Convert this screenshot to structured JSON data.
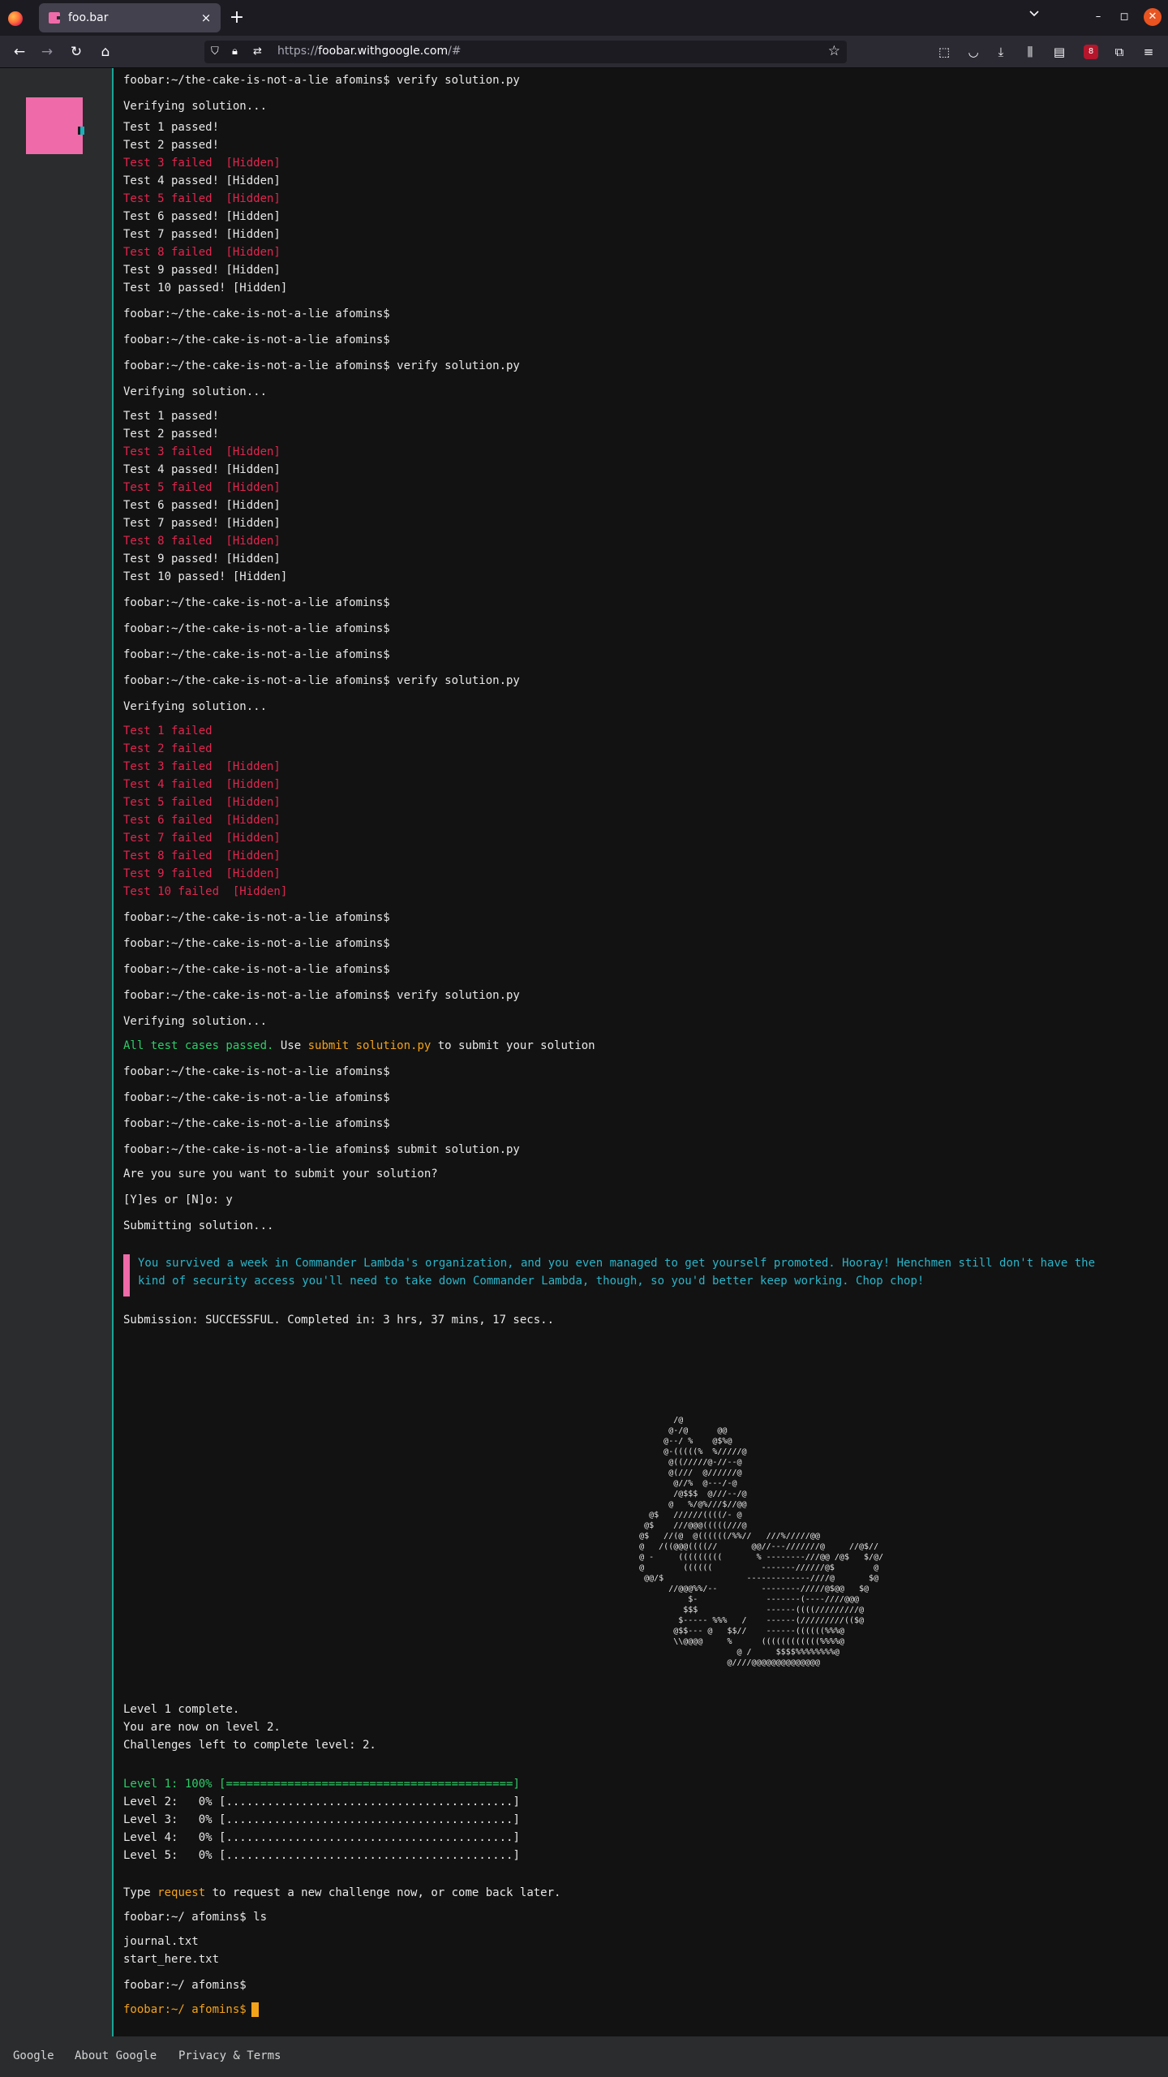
{
  "browser": {
    "tab_title": "foo.bar",
    "tab_close": "×",
    "new_tab": "+",
    "url_prefix": "https://",
    "url_host": "foobar.withgoogle.com",
    "url_suffix": "/#",
    "ublock_badge": "8"
  },
  "terminal": {
    "lines": [
      {
        "text": "foobar:~/the-cake-is-not-a-lie afomins$ verify solution.py"
      },
      {
        "text": "Verifying solution..."
      },
      {
        "text": "Test 1 passed!"
      },
      {
        "text": "Test 2 passed!"
      },
      {
        "text": "Test 3 failed  [Hidden]",
        "cls": "red"
      },
      {
        "text": "Test 4 passed! [Hidden]"
      },
      {
        "text": "Test 5 failed  [Hidden]",
        "cls": "red"
      },
      {
        "text": "Test 6 passed! [Hidden]"
      },
      {
        "text": "Test 7 passed! [Hidden]"
      },
      {
        "text": "Test 8 failed  [Hidden]",
        "cls": "red"
      },
      {
        "text": "Test 9 passed! [Hidden]"
      },
      {
        "text": "Test 10 passed! [Hidden]"
      },
      {
        "text": "foobar:~/the-cake-is-not-a-lie afomins$"
      },
      {
        "text": "foobar:~/the-cake-is-not-a-lie afomins$"
      },
      {
        "text": "foobar:~/the-cake-is-not-a-lie afomins$ verify solution.py"
      },
      {
        "text": "Verifying solution..."
      },
      {
        "text": "Test 1 passed!"
      },
      {
        "text": "Test 2 passed!"
      },
      {
        "text": "Test 3 failed  [Hidden]",
        "cls": "red"
      },
      {
        "text": "Test 4 passed! [Hidden]"
      },
      {
        "text": "Test 5 failed  [Hidden]",
        "cls": "red"
      },
      {
        "text": "Test 6 passed! [Hidden]"
      },
      {
        "text": "Test 7 passed! [Hidden]"
      },
      {
        "text": "Test 8 failed  [Hidden]",
        "cls": "red"
      },
      {
        "text": "Test 9 passed! [Hidden]"
      },
      {
        "text": "Test 10 passed! [Hidden]"
      },
      {
        "text": "foobar:~/the-cake-is-not-a-lie afomins$"
      },
      {
        "text": "foobar:~/the-cake-is-not-a-lie afomins$"
      },
      {
        "text": "foobar:~/the-cake-is-not-a-lie afomins$"
      },
      {
        "text": "foobar:~/the-cake-is-not-a-lie afomins$ verify solution.py"
      },
      {
        "text": "Verifying solution..."
      },
      {
        "text": "Test 1 failed",
        "cls": "red"
      },
      {
        "text": "Test 2 failed",
        "cls": "red"
      },
      {
        "text": "Test 3 failed  [Hidden]",
        "cls": "red"
      },
      {
        "text": "Test 4 failed  [Hidden]",
        "cls": "red"
      },
      {
        "text": "Test 5 failed  [Hidden]",
        "cls": "red"
      },
      {
        "text": "Test 6 failed  [Hidden]",
        "cls": "red"
      },
      {
        "text": "Test 7 failed  [Hidden]",
        "cls": "red"
      },
      {
        "text": "Test 8 failed  [Hidden]",
        "cls": "red"
      },
      {
        "text": "Test 9 failed  [Hidden]",
        "cls": "red"
      },
      {
        "text": "Test 10 failed  [Hidden]",
        "cls": "red"
      },
      {
        "text": "foobar:~/the-cake-is-not-a-lie afomins$"
      },
      {
        "text": "foobar:~/the-cake-is-not-a-lie afomins$"
      },
      {
        "text": "foobar:~/the-cake-is-not-a-lie afomins$"
      },
      {
        "text": "foobar:~/the-cake-is-not-a-lie afomins$ verify solution.py"
      },
      {
        "text": "Verifying solution..."
      },
      {
        "segments": [
          {
            "text": "All test cases passed.",
            "cls": "green"
          },
          {
            "text": " Use "
          },
          {
            "text": "submit solution.py",
            "cls": "orange"
          },
          {
            "text": " to submit your solution"
          }
        ]
      },
      {
        "text": "foobar:~/the-cake-is-not-a-lie afomins$"
      },
      {
        "text": "foobar:~/the-cake-is-not-a-lie afomins$"
      },
      {
        "text": "foobar:~/the-cake-is-not-a-lie afomins$"
      },
      {
        "text": "foobar:~/the-cake-is-not-a-lie afomins$ submit solution.py"
      },
      {
        "text": "Are you sure you want to submit your solution?"
      },
      {
        "text": "[Y]es or [N]o: y"
      },
      {
        "text": "Submitting solution..."
      }
    ],
    "message": "You survived a week in Commander Lambda's organization, and you even managed to get yourself promoted. Hooray! Henchmen still don't have the kind of security access you'll need to take down Commander Lambda, though, so you'd better keep working. Chop chop!",
    "submission_result": "Submission: SUCCESSFUL. Completed in: 3 hrs, 37 mins, 17 secs..",
    "ascii_art": "           /@\n          @-/@      @@\n         @--/ %    @$%@\n         @-(((((%  %/////@\n          @((/////@-//--@\n          @(///  @//////@\n           @//%  @---/-@\n           /@$$$  @///--/@\n          @   %/@%///$//@@\n      @$   //////((((/- @\n     @$    ///@@@(((((///@\n    @$   //(@  @((((((/%%//   ///%/////@@\n    @   /((@@@((((//       @@//---///////@     //@$//\n    @ -     (((((((((       % --------///@@ /@$   $/@/\n    @        ((((((          -------//////@$        @\n     @@/$                 -------------////@       $@\n          //@@@%%/--         --------/////@$@@   $@\n              $-              -------(----////@@@\n             $$$              ------((((/////////@\n            $----- %%%   /    ------(/////////(($@\n           @$$--- @   $$//    ------((((((%%%@\n           \\\\@@@@     %      ((((((((((((%%%%@\n                        @ /     $$$$%%%%%%%%@\n                      @////@@@@@@@@@@@@@@",
    "level_info": [
      "Level 1 complete.",
      "You are now on level 2.",
      "Challenges left to complete level: 2."
    ],
    "levels": [
      {
        "label": "Level 1:",
        "percent": "100%",
        "progress": 1.0
      },
      {
        "label": "Level 2:",
        "percent": "0%",
        "progress": 0
      },
      {
        "label": "Level 3:",
        "percent": "0%",
        "progress": 0
      },
      {
        "label": "Level 4:",
        "percent": "0%",
        "progress": 0
      },
      {
        "label": "Level 5:",
        "percent": "0%",
        "progress": 0
      }
    ],
    "request_prefix": "Type ",
    "request_word": "request",
    "request_suffix": " to request a new challenge now, or come back later.",
    "ls_command": "foobar:~/ afomins$ ls",
    "files": [
      "journal.txt",
      "start_here.txt"
    ],
    "empty_prompt": "foobar:~/ afomins$",
    "active_prompt": "foobar:~/ afomins$",
    "colors": {
      "error": "#e1264f",
      "success": "#2ece6a",
      "highlight": "#f3a21a",
      "message": "#29b5c9",
      "accent": "#ef6aa8"
    }
  },
  "footer": {
    "links": [
      "Google",
      "About Google",
      "Privacy & Terms"
    ]
  }
}
